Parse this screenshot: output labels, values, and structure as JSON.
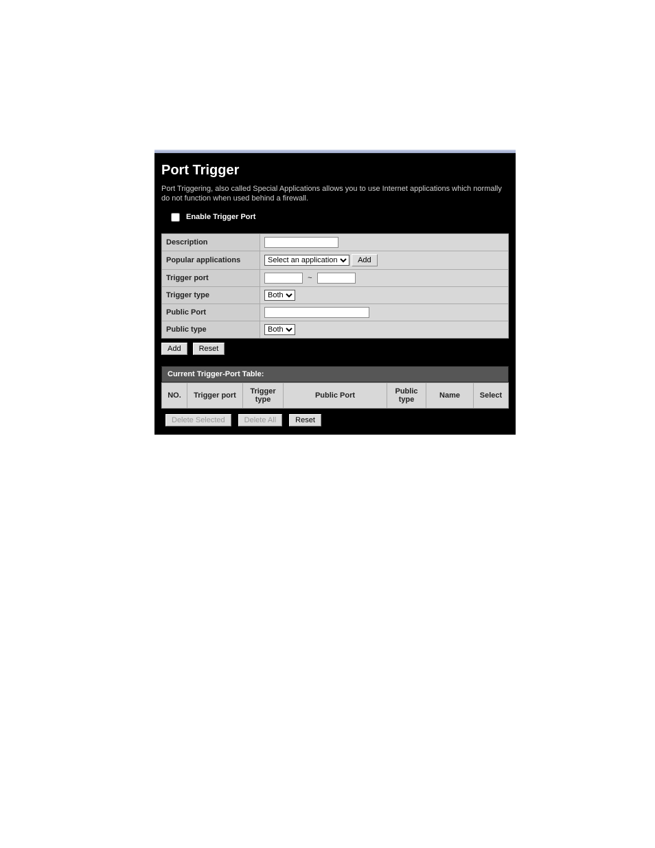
{
  "page": {
    "title": "Port Trigger",
    "intro": "Port Triggering, also called Special Applications allows you to use Internet applications which normally do not function when used behind a firewall."
  },
  "enable": {
    "label": "Enable Trigger Port"
  },
  "form": {
    "description_label": "Description",
    "popular_label": "Popular applications",
    "popular_selected": "Select an application",
    "popular_add_btn": "Add",
    "trigger_port_label": "Trigger port",
    "trigger_separator": "~",
    "trigger_type_label": "Trigger type",
    "trigger_type_value": "Both",
    "public_port_label": "Public Port",
    "public_type_label": "Public type",
    "public_type_value": "Both",
    "add_btn": "Add",
    "reset_btn": "Reset"
  },
  "table": {
    "header": "Current Trigger-Port Table:",
    "cols": {
      "no": "NO.",
      "trigger_port": "Trigger port",
      "trigger_type": "Trigger type",
      "public_port": "Public Port",
      "public_type": "Public type",
      "name": "Name",
      "select": "Select"
    }
  },
  "actions": {
    "delete_selected": "Delete Selected",
    "delete_all": "Delete All",
    "reset": "Reset"
  }
}
